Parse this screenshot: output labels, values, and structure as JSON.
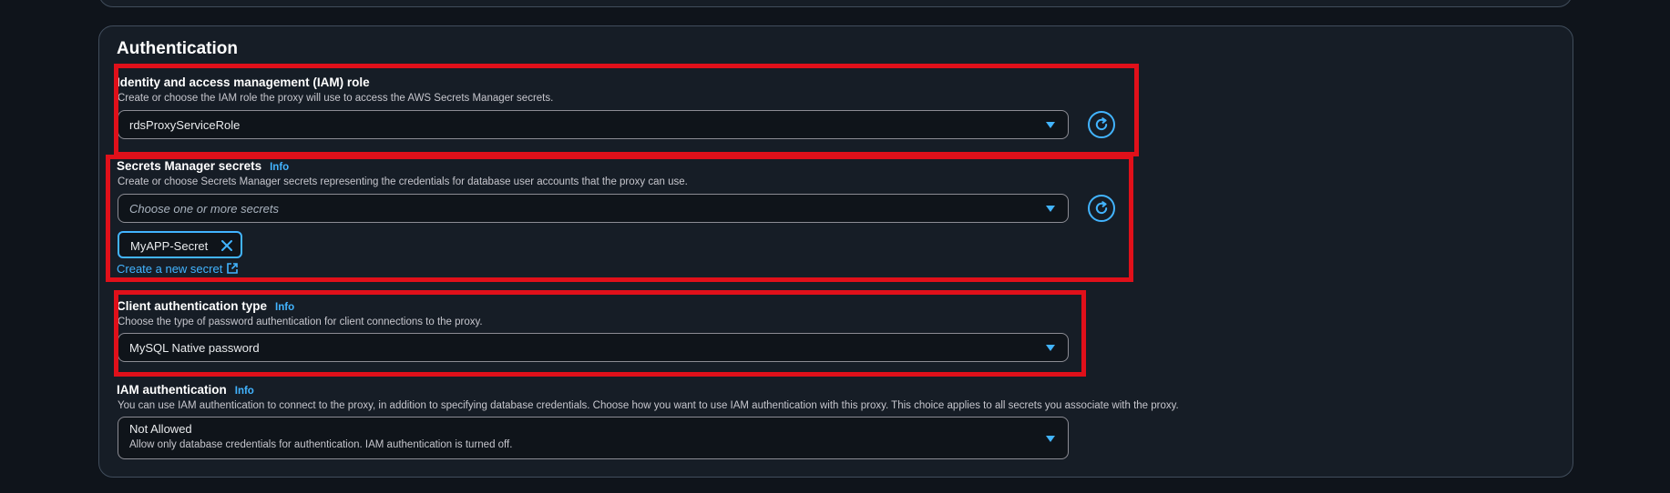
{
  "section": {
    "title": "Authentication"
  },
  "iam_role": {
    "label": "Identity and access management (IAM) role",
    "description": "Create or choose the IAM role the proxy will use to access the AWS Secrets Manager secrets.",
    "selected_value": "rdsProxyServiceRole",
    "refresh_icon": "refresh-icon"
  },
  "secrets": {
    "label": "Secrets Manager secrets",
    "info": "Info",
    "description": "Create or choose Secrets Manager secrets representing the credentials for database user accounts that the proxy can use.",
    "placeholder": "Choose one or more secrets",
    "selected_tokens": [
      "MyAPP-Secret"
    ],
    "create_link": "Create a new secret",
    "refresh_icon": "refresh-icon"
  },
  "client_auth": {
    "label": "Client authentication type",
    "info": "Info",
    "description": "Choose the type of password authentication for client connections to the proxy.",
    "selected_value": "MySQL Native password"
  },
  "iam_auth": {
    "label": "IAM authentication",
    "info": "Info",
    "description": "You can use IAM authentication to connect to the proxy, in addition to specifying database credentials. Choose how you want to use IAM authentication with this proxy. This choice applies to all secrets you associate with the proxy.",
    "selected_value": "Not Allowed",
    "selected_description": "Allow only database credentials for authentication. IAM authentication is turned off."
  },
  "colors": {
    "background": "#0f141b",
    "panel": "#161d26",
    "accent": "#42b4ff",
    "highlight": "#e0101a"
  }
}
